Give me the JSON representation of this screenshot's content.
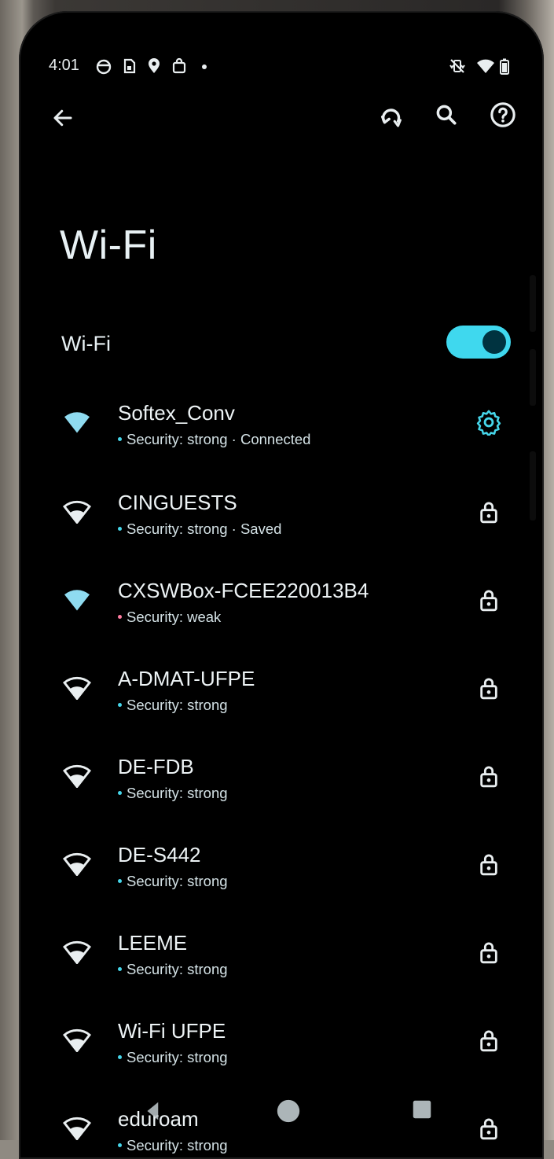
{
  "status_bar": {
    "time": "4:01",
    "notification_icons": [
      "circle-app-icon",
      "sim-card-icon",
      "location-pin-icon",
      "shopping-bag-icon",
      "dot-icon"
    ],
    "right_icons": [
      "vibrate-off-icon",
      "wifi-signal-icon",
      "battery-icon"
    ]
  },
  "toolbar": {
    "back": "back-arrow-icon",
    "refresh": "refresh-icon",
    "search": "search-icon",
    "help": "help-icon"
  },
  "page": {
    "title": "Wi-Fi",
    "toggle_label": "Wi-Fi",
    "toggle_on": true
  },
  "colors": {
    "accent": "#3fd8ee",
    "background": "#000000",
    "text": "#e8f1f4",
    "weak_dot": "#ff7da1"
  },
  "networks": [
    {
      "name": "Softex_Conv",
      "subtitle": "Security: strong · Connected",
      "security": "strong",
      "action_icon": "gear-icon",
      "signal": "full"
    },
    {
      "name": "CINGUESTS",
      "subtitle": "Security: strong · Saved",
      "security": "strong",
      "action_icon": "lock-icon",
      "signal": "partial"
    },
    {
      "name": "CXSWBox-FCEE220013B4",
      "subtitle": "Security: weak",
      "security": "weak",
      "action_icon": "lock-icon",
      "signal": "full"
    },
    {
      "name": "A-DMAT-UFPE",
      "subtitle": "Security: strong",
      "security": "strong",
      "action_icon": "lock-icon",
      "signal": "partial"
    },
    {
      "name": "DE-FDB",
      "subtitle": "Security: strong",
      "security": "strong",
      "action_icon": "lock-icon",
      "signal": "partial"
    },
    {
      "name": "DE-S442",
      "subtitle": "Security: strong",
      "security": "strong",
      "action_icon": "lock-icon",
      "signal": "partial"
    },
    {
      "name": "LEEME",
      "subtitle": "Security: strong",
      "security": "strong",
      "action_icon": "lock-icon",
      "signal": "partial"
    },
    {
      "name": "Wi-Fi UFPE",
      "subtitle": "Security: strong",
      "security": "strong",
      "action_icon": "lock-icon",
      "signal": "partial"
    },
    {
      "name": "eduroam",
      "subtitle": "Security: strong",
      "security": "strong",
      "action_icon": "lock-icon",
      "signal": "partial"
    }
  ],
  "nav_bar": {
    "back": "nav-back-icon",
    "home": "nav-home-icon",
    "recents": "nav-recents-icon"
  }
}
